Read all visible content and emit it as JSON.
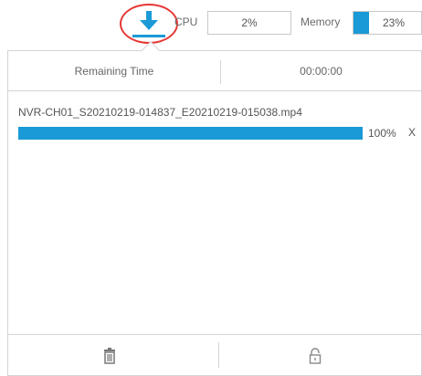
{
  "status_bar": {
    "download_icon": "download-icon",
    "cpu_label": "CPU",
    "cpu_value": "2%",
    "memory_label": "Memory",
    "memory_value": "23%",
    "memory_fraction": 0.23
  },
  "panel": {
    "remaining_time_label": "Remaining Time",
    "remaining_time_value": "00:00:00",
    "items": [
      {
        "file_name": "NVR-CH01_S20210219-014837_E20210219-015038.mp4",
        "progress_text": "100%",
        "progress_fraction": 1.0,
        "remove_label": "X"
      }
    ],
    "footer": {
      "delete_icon": "trash-icon",
      "lock_icon": "lock-icon"
    }
  },
  "colors": {
    "accent": "#1a9ad6",
    "highlight_ring": "#e53935",
    "border": "#d4d4d4"
  }
}
